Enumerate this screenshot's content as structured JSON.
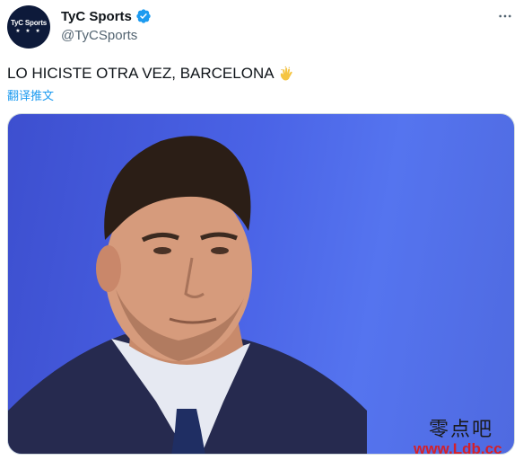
{
  "author": {
    "display_name": "TyC Sports",
    "handle": "@TyCSports",
    "avatar_text": "TyC Sports",
    "avatar_stars": "★ ★ ★",
    "verified": true,
    "avatar_bg": "#0d1a3a"
  },
  "tweet": {
    "text": "LO HICISTE OTRA VEZ, BARCELONA",
    "emoji": "clapping-hands",
    "translate_label": "翻译推文"
  },
  "media": {
    "type": "photo",
    "description_icon": "portrait-photo"
  },
  "watermark": {
    "chinese": "零点吧",
    "url": "www.Ldb.cc"
  },
  "colors": {
    "link": "#1d9bf0",
    "secondary_text": "#536471",
    "verified": "#1d9bf0",
    "background_photo": "#4a63e6"
  }
}
